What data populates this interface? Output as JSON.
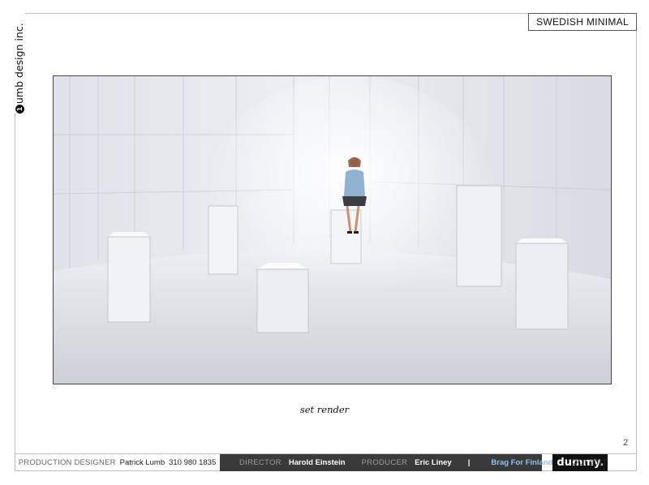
{
  "logo": {
    "mark": "1",
    "text": "umb design inc."
  },
  "header": {
    "title": "SWEDISH MINIMAL"
  },
  "image": {
    "caption": "set render"
  },
  "page_number": "2",
  "footer": {
    "designer_label": "PRODUCTION DESIGNER",
    "designer_name": "Patrick Lumb",
    "designer_phone": "310 980 1835",
    "director_label": "DIRECTOR",
    "director_name": "Harold Einstein",
    "producer_label": "PRODUCER",
    "producer_name": "Eric Liney",
    "separator": "|",
    "project": "Brag For Finland",
    "company": "dummy.",
    "date": "OCT 2017"
  },
  "colors": {
    "project_accent": "#8fc4ec",
    "footer_dark": "#3a3a3a"
  }
}
